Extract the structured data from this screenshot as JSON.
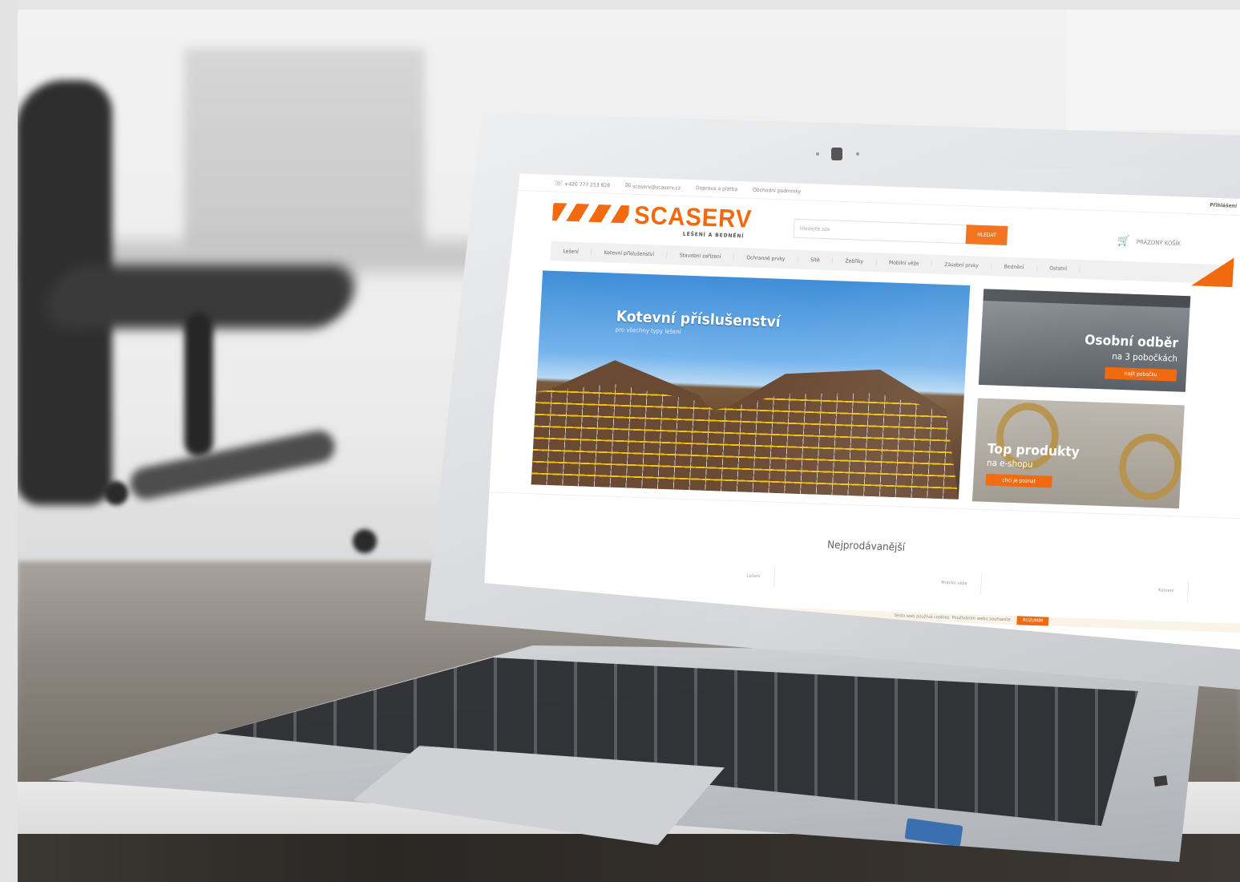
{
  "site": {
    "topbar": {
      "phone": "+420 777 253 628",
      "email": "scaserv@scaserv.cz",
      "link1": "Doprava a platba",
      "link2": "Obchodní podmínky",
      "login": "Přihlášení"
    },
    "logo": {
      "text": "SCASERV",
      "sub": "LEŠENÍ A BEDNĚNÍ"
    },
    "search": {
      "placeholder": "Hledejte zde",
      "button": "HLEDAT"
    },
    "cart": {
      "label": "PRÁZDNÝ KOŠÍK"
    },
    "nav": [
      "Lešení",
      "Kotevní příslušenství",
      "Stavební zařízení",
      "Ochranné prvky",
      "Sítě",
      "Žebříky",
      "Mobilní věže",
      "Zásobní prvky",
      "Bednění",
      "Ostatní"
    ],
    "hero": {
      "title": "Kotevní příslušenství",
      "subtitle": "pro všechny typy lešení"
    },
    "promo1": {
      "title": "Osobní odběr",
      "subtitle": "na 3 pobočkách",
      "button": "najít pobočku"
    },
    "promo2": {
      "title": "Top produkty",
      "subtitle": "na e-shopu",
      "button": "chci je poznat"
    },
    "best_sellers": {
      "title": "Nejprodávanější"
    },
    "tabs": [
      "Lešení",
      "Mobilní věže",
      "Kotvení"
    ],
    "cookie": {
      "text": "Tento web používá cookies. Používáním webu souhlasíte.",
      "button": "ROZUMÍM"
    }
  },
  "colors": {
    "accent": "#f26a10",
    "nav_bg": "#f0f0f0"
  },
  "icons": {
    "phone": "phone-icon",
    "email": "mail-icon",
    "cart": "cart-icon"
  }
}
